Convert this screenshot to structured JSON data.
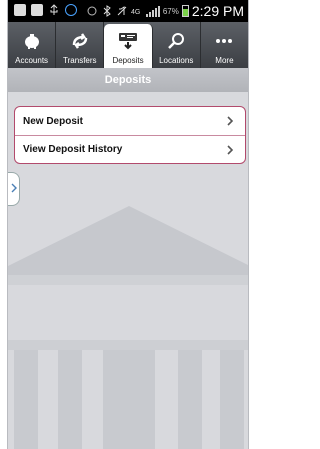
{
  "status_bar": {
    "battery": "67%",
    "time": "2:29 PM"
  },
  "tabs": [
    {
      "label": "Accounts",
      "icon": "piggy-bank-icon"
    },
    {
      "label": "Transfers",
      "icon": "transfer-arrows-icon"
    },
    {
      "label": "Deposits",
      "icon": "deposit-icon",
      "active": true
    },
    {
      "label": "Locations",
      "icon": "search-icon"
    },
    {
      "label": "More",
      "icon": "more-dots-icon"
    }
  ],
  "title": "Deposits",
  "menu": [
    {
      "label": "New Deposit"
    },
    {
      "label": "View Deposit History"
    }
  ],
  "colors": {
    "accent_border": "#b24a6c",
    "background": "#d8d9dd"
  }
}
